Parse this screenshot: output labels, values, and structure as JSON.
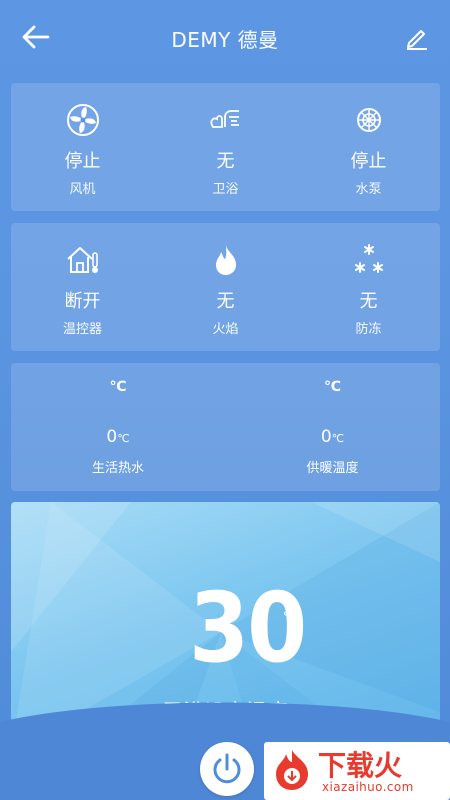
{
  "header": {
    "title": "DEMY 德曼",
    "back_icon": "arrow-left-icon",
    "edit_icon": "pencil-icon"
  },
  "status_row1": [
    {
      "icon": "fan-icon",
      "value": "停止",
      "label": "风机"
    },
    {
      "icon": "bath-icon",
      "value": "无",
      "label": "卫浴"
    },
    {
      "icon": "pump-icon",
      "value": "停止",
      "label": "水泵"
    }
  ],
  "status_row2": [
    {
      "icon": "house-thermostat-icon",
      "value": "断开",
      "label": "温控器"
    },
    {
      "icon": "flame-icon",
      "value": "无",
      "label": "火焰"
    },
    {
      "icon": "snowflake-icon",
      "value": "无",
      "label": "防冻"
    }
  ],
  "temps": [
    {
      "unit": "℃",
      "value": "0",
      "value_unit": "℃",
      "label": "生活热水"
    },
    {
      "unit": "℃",
      "value": "0",
      "value_unit": "℃",
      "label": "供暖温度"
    }
  ],
  "setpoint": {
    "value": "30",
    "unit": "℃",
    "label": "卫浴设定温度"
  },
  "controls": {
    "power_icon": "power-icon"
  },
  "watermark": {
    "text": "下载火",
    "sub": "xiazaihuo.com"
  },
  "colors": {
    "background": "#5b95e1",
    "panel": "#7cc6f0",
    "brand_red": "#e83b2e"
  }
}
